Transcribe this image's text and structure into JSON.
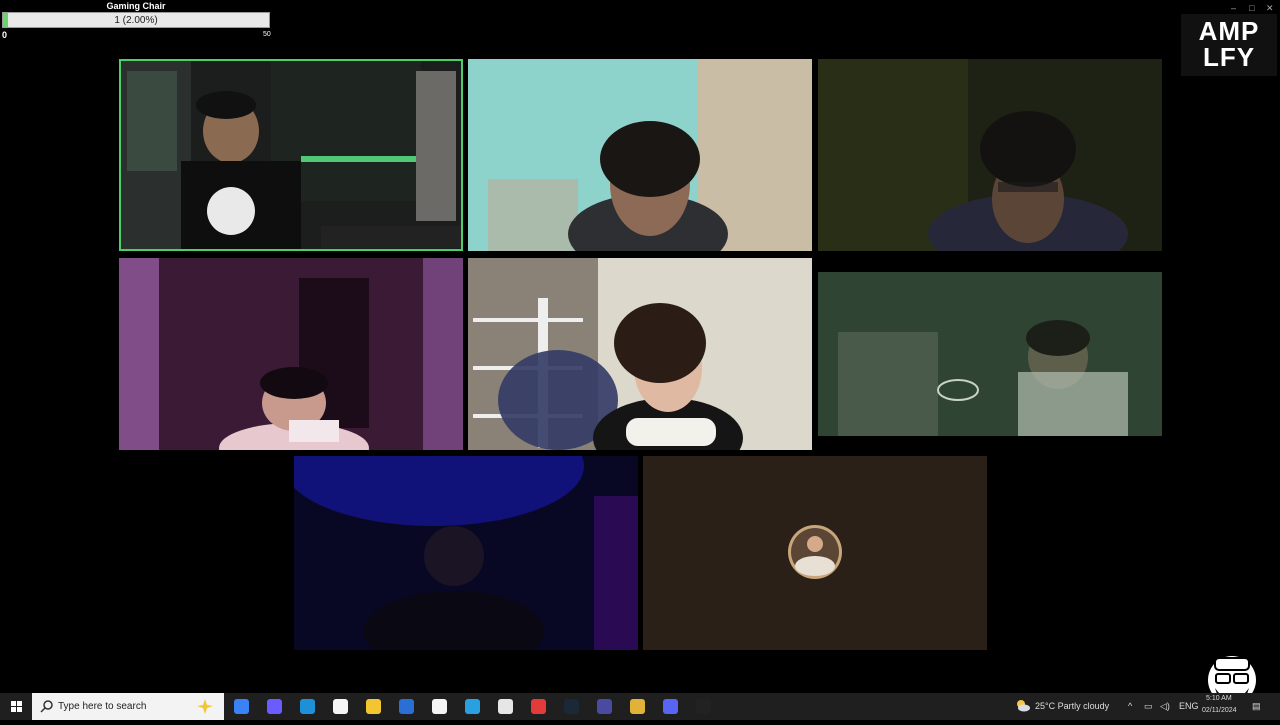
{
  "goal": {
    "title": "Gaming Chair",
    "progress_text": "1 (2.00%)",
    "progress_fraction": 0.02,
    "min": "0",
    "max": "50"
  },
  "brand": {
    "line1": "AMP",
    "line2": "LFY"
  },
  "window": {
    "min_glyph": "–",
    "max_glyph": "□",
    "close_glyph": "✕"
  },
  "taskbar": {
    "search_placeholder": "Type here to search",
    "apps": [
      "copilot-icon",
      "teams-icon",
      "edge-icon",
      "store-icon",
      "file-explorer-icon",
      "outlook-icon",
      "chrome-icon",
      "notes-icon",
      "tool-icon",
      "news-icon",
      "steam-icon",
      "app-grid-icon",
      "app-tool-icon",
      "discord-icon",
      "obs-icon"
    ],
    "weather": "25°C  Partly cloudy",
    "lang": "ENG",
    "time": "5:10 AM",
    "date": "02/11/2024"
  }
}
